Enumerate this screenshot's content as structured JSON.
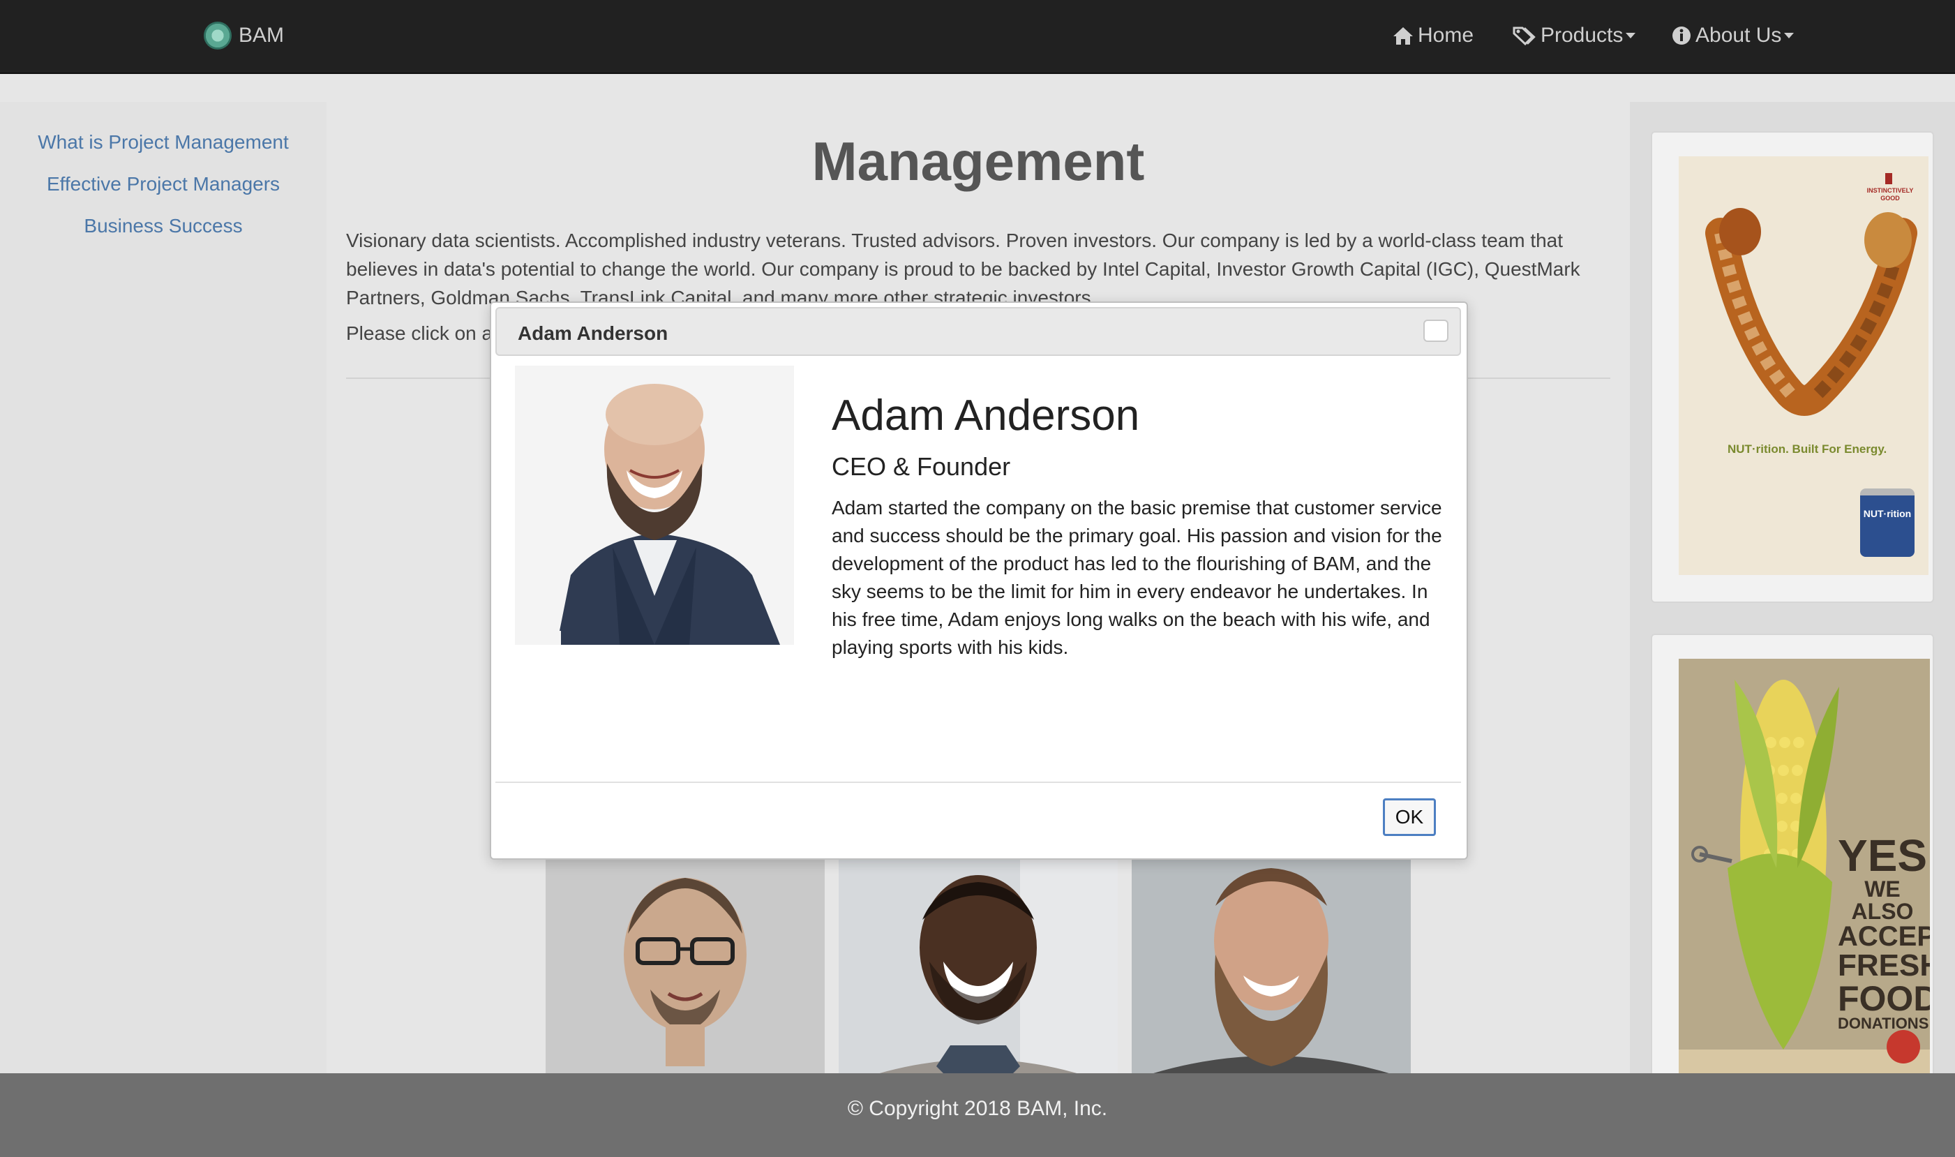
{
  "navbar": {
    "brand": "BAM",
    "items": [
      {
        "label": "Home",
        "icon": "home-icon"
      },
      {
        "label": "Products",
        "icon": "tag-icon"
      },
      {
        "label": "About Us",
        "icon": "info-icon"
      }
    ]
  },
  "sidebar": {
    "links": [
      "What is Project Management",
      "Effective Project Managers",
      "Business Success"
    ]
  },
  "main": {
    "title": "Management",
    "intro": "Visionary data scientists. Accomplished industry veterans. Trusted advisors. Proven investors. Our company is led by a world-class team that believes in data's potential to change the world. Our company is proud to be backed by Intel Capital, Investor Growth Capital (IGC), QuestMark Partners, Goldman Sachs, TransLink Capital, and many more other strategic investors.",
    "click_text": "Please click on a"
  },
  "modal": {
    "title": "Adam Anderson",
    "name": "Adam Anderson",
    "role": "CEO & Founder",
    "bio": "Adam started the company on the basic premise that customer service and success should be the primary goal. His passion and vision for the development of the product has led to the flourishing of BAM, and the sky seems to be the limit for him in every endeavor he undertakes. In his free time, Adam enjoys long walks on the beach with his wife, and playing sports with his kids.",
    "ok_label": "OK"
  },
  "ads": {
    "nut": {
      "brand": "INSTINCTIVELY GOOD",
      "tagline": "NUT·rition. Built For Energy.",
      "can_label": "NUT·rition"
    },
    "corn": {
      "line1": "YES",
      "line2": "WE ALSO",
      "line3": "ACCEPT",
      "line4": "FRESH",
      "line5": "FOOD",
      "line6": "DONATIONS"
    }
  },
  "footer": {
    "copyright": "© Copyright 2018 BAM, Inc."
  },
  "colors": {
    "navbar": "#212121",
    "link": "#4b77a8",
    "footer": "#6f6f6f",
    "ok_border": "#4d7fc2"
  }
}
